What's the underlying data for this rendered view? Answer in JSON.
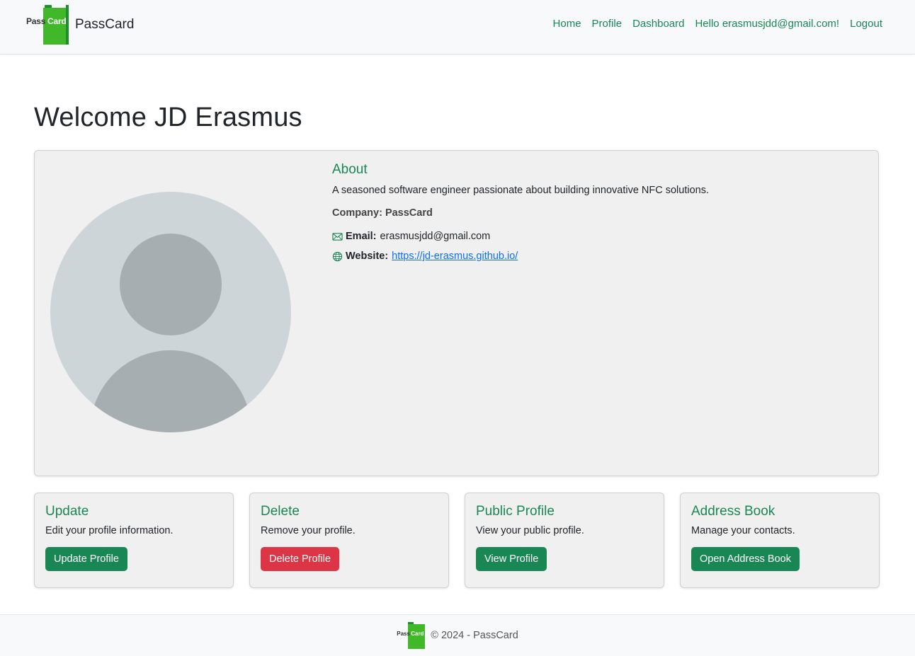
{
  "navbar": {
    "logo_pass": "Pass",
    "logo_card": "Card",
    "brand": "PassCard",
    "links": [
      "Home",
      "Profile",
      "Dashboard",
      "Hello erasmusjdd@gmail.com!",
      "Logout"
    ]
  },
  "main": {
    "title": "Welcome JD Erasmus",
    "about": {
      "heading": "About",
      "bio": "A seasoned software engineer passionate about building innovative NFC solutions.",
      "company_label": "Company:",
      "company_value": "PassCard",
      "email_label": "Email:",
      "email_value": "erasmusjdd@gmail.com",
      "website_label": "Website:",
      "website_value": "https://jd-erasmus.github.io/"
    }
  },
  "cards": [
    {
      "title": "Update",
      "text": "Edit your profile information.",
      "button": "Update Profile"
    },
    {
      "title": "Delete",
      "text": "Remove your profile.",
      "button": "Delete Profile"
    },
    {
      "title": "Public Profile",
      "text": "View your public profile.",
      "button": "View Profile"
    },
    {
      "title": "Address Book",
      "text": "Manage your contacts.",
      "button": "Open Address Book"
    }
  ],
  "footer": {
    "logo_pass": "Pass",
    "logo_card": "Card",
    "text": "© 2024 - PassCard"
  },
  "colors": {
    "accent_green": "#198754",
    "danger_red": "#dc3545",
    "link_blue": "#0d6efd",
    "logo_green": "#41b82a"
  },
  "icons": {
    "email": "envelope-icon",
    "website": "globe-icon",
    "avatar": "user-placeholder-icon"
  }
}
